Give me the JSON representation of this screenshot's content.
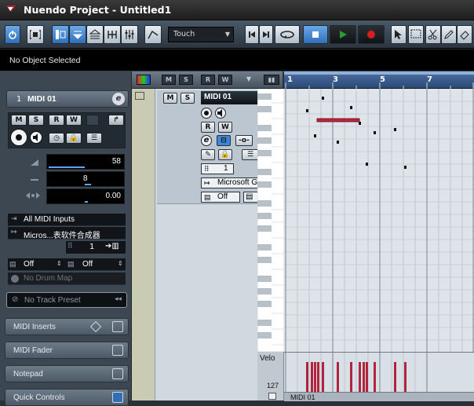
{
  "window": {
    "title": "Nuendo Project - Untitled1"
  },
  "toolbar": {
    "automation_mode": "Touch"
  },
  "info_line": {
    "text": "No Object Selected"
  },
  "inspector": {
    "track_number": "1",
    "track_name": "MIDI 01",
    "volume": "58",
    "transpose": "8",
    "delay": "0.00",
    "input": "All MIDI Inputs",
    "output": "Micros...表软件合成器",
    "channel": "1",
    "bank": "Off",
    "program": "Off",
    "drum_map": "No Drum Map",
    "track_preset": "No Track Preset",
    "sections": [
      "MIDI Inserts",
      "MIDI Fader",
      "Notepad",
      "Quick Controls"
    ]
  },
  "track": {
    "name": "MIDI 01",
    "output": "Microsoft G",
    "channel": "1",
    "program": "Off"
  },
  "ruler": {
    "labels": [
      "1",
      "3",
      "5",
      "7"
    ]
  },
  "velocity": {
    "label": "Velo",
    "max": "127"
  },
  "bottom_track": {
    "name": "MIDI 01"
  },
  "colors": {
    "accent": "#2f6fb8",
    "note": "#c0243c",
    "ruler": "#2a4a7a"
  }
}
